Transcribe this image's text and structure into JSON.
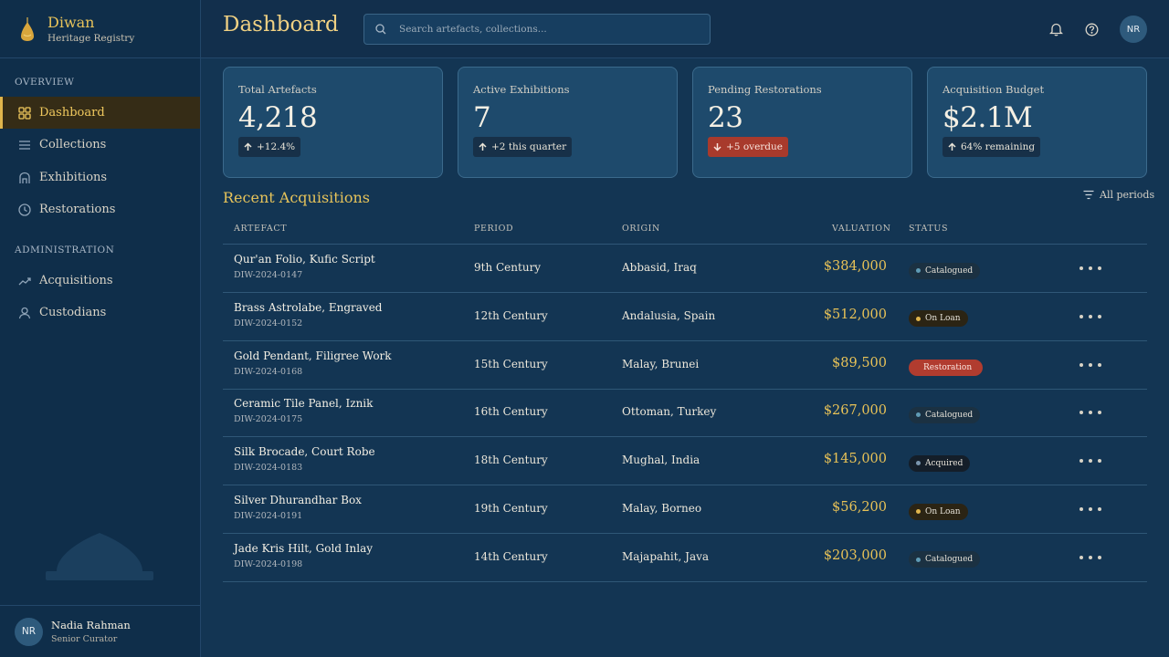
{
  "brand": {
    "name": "Diwan",
    "subtitle": "Heritage Registry"
  },
  "sidebar": {
    "sections": [
      {
        "label": "OVERVIEW"
      },
      {
        "label": "ADMINISTRATION"
      }
    ],
    "items": [
      {
        "label": "Dashboard",
        "icon": "grid-icon",
        "active": true
      },
      {
        "label": "Collections",
        "icon": "list-icon"
      },
      {
        "label": "Exhibitions",
        "icon": "museum-icon"
      },
      {
        "label": "Restorations",
        "icon": "clock-icon"
      },
      {
        "label": "Acquisitions",
        "icon": "trend-icon"
      },
      {
        "label": "Custodians",
        "icon": "user-icon"
      }
    ],
    "profile": {
      "initials": "NR",
      "name": "Nadia Rahman",
      "role": "Senior Curator"
    }
  },
  "header": {
    "title": "Dashboard",
    "search_placeholder": "Search artefacts, collections...",
    "user_initials": "NR"
  },
  "stats": [
    {
      "label": "Total Artefacts",
      "value": "4,218",
      "delta": "+12.4%",
      "trend": "up"
    },
    {
      "label": "Active Exhibitions",
      "value": "7",
      "delta": "+2 this quarter",
      "trend": "up"
    },
    {
      "label": "Pending Restorations",
      "value": "23",
      "delta": "+5 overdue",
      "trend": "down-alert"
    },
    {
      "label": "Acquisition Budget",
      "value": "$2.1M",
      "delta": "64% remaining",
      "trend": "up"
    }
  ],
  "acquisitions": {
    "title": "Recent Acquisitions",
    "filter_label": "All periods",
    "columns": [
      "ARTEFACT",
      "PERIOD",
      "ORIGIN",
      "VALUATION",
      "STATUS"
    ],
    "rows": [
      {
        "name": "Qur'an Folio, Kufic Script",
        "id": "DIW-2024-0147",
        "period": "9th Century",
        "origin": "Abbasid, Iraq",
        "valuation": "$384,000",
        "status": "Catalogued"
      },
      {
        "name": "Brass Astrolabe, Engraved",
        "id": "DIW-2024-0152",
        "period": "12th Century",
        "origin": "Andalusia, Spain",
        "valuation": "$512,000",
        "status": "On Loan"
      },
      {
        "name": "Gold Pendant, Filigree Work",
        "id": "DIW-2024-0168",
        "period": "15th Century",
        "origin": "Malay, Brunei",
        "valuation": "$89,500",
        "status": "Restoration"
      },
      {
        "name": "Ceramic Tile Panel, Iznik",
        "id": "DIW-2024-0175",
        "period": "16th Century",
        "origin": "Ottoman, Turkey",
        "valuation": "$267,000",
        "status": "Catalogued"
      },
      {
        "name": "Silk Brocade, Court Robe",
        "id": "DIW-2024-0183",
        "period": "18th Century",
        "origin": "Mughal, India",
        "valuation": "$145,000",
        "status": "Acquired"
      },
      {
        "name": "Silver Dhurandhar Box",
        "id": "DIW-2024-0191",
        "period": "19th Century",
        "origin": "Malay, Borneo",
        "valuation": "$56,200",
        "status": "On Loan"
      },
      {
        "name": "Jade Kris Hilt, Gold Inlay",
        "id": "DIW-2024-0198",
        "period": "14th Century",
        "origin": "Majapahit, Java",
        "valuation": "$203,000",
        "status": "Catalogued"
      }
    ]
  },
  "colors": {
    "accent": "#e0b54c",
    "alert": "#a83a2c",
    "background": "#133553"
  }
}
